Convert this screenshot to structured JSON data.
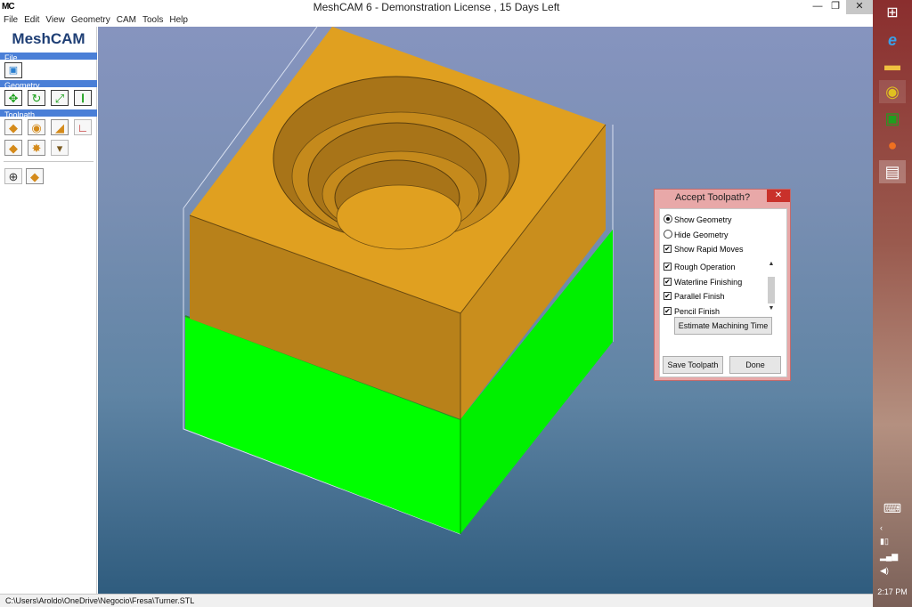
{
  "window": {
    "app_icon": "MC",
    "title": "MeshCAM 6 - Demonstration License  , 15 Days Left",
    "minimize_icon": "minimize-icon",
    "maximize_icon": "restore-icon",
    "close_icon": "close-icon"
  },
  "menu": [
    {
      "label": "File"
    },
    {
      "label": "Edit"
    },
    {
      "label": "View"
    },
    {
      "label": "Geometry"
    },
    {
      "label": "CAM"
    },
    {
      "label": "Tools"
    },
    {
      "label": "Help"
    }
  ],
  "panel": {
    "logo": "MeshCAM",
    "sections": {
      "file": "File",
      "geometry": "Geometry",
      "toolpath": "Toolpath"
    }
  },
  "status": {
    "path": "C:\\Users\\Aroldo\\OneDrive\\Negocio\\Fresa\\Turner.STL"
  },
  "dialog": {
    "title": "Accept Toolpath?",
    "close": "✕",
    "show_geometry": "Show Geometry",
    "hide_geometry": "Hide Geometry",
    "show_rapid_moves": "Show Rapid Moves",
    "operations": [
      {
        "label": "Rough Operation",
        "checked": true
      },
      {
        "label": "Waterline Finishing",
        "checked": true
      },
      {
        "label": "Parallel Finish",
        "checked": true
      },
      {
        "label": "Pencil Finish",
        "checked": true
      }
    ],
    "estimate_button": "Estimate Machining Time",
    "save_button": "Save Toolpath",
    "done_button": "Done"
  },
  "taskbar": {
    "clock": "2:17 PM"
  },
  "colors": {
    "accent": "#4a7fd7",
    "model_top": "#e0a020",
    "model_side_front": "#b8811a",
    "model_side_right": "#c98e1d",
    "stock_green": "#00ff00",
    "dialog_frame": "#e8a8a8",
    "dialog_close": "#c9312b"
  }
}
